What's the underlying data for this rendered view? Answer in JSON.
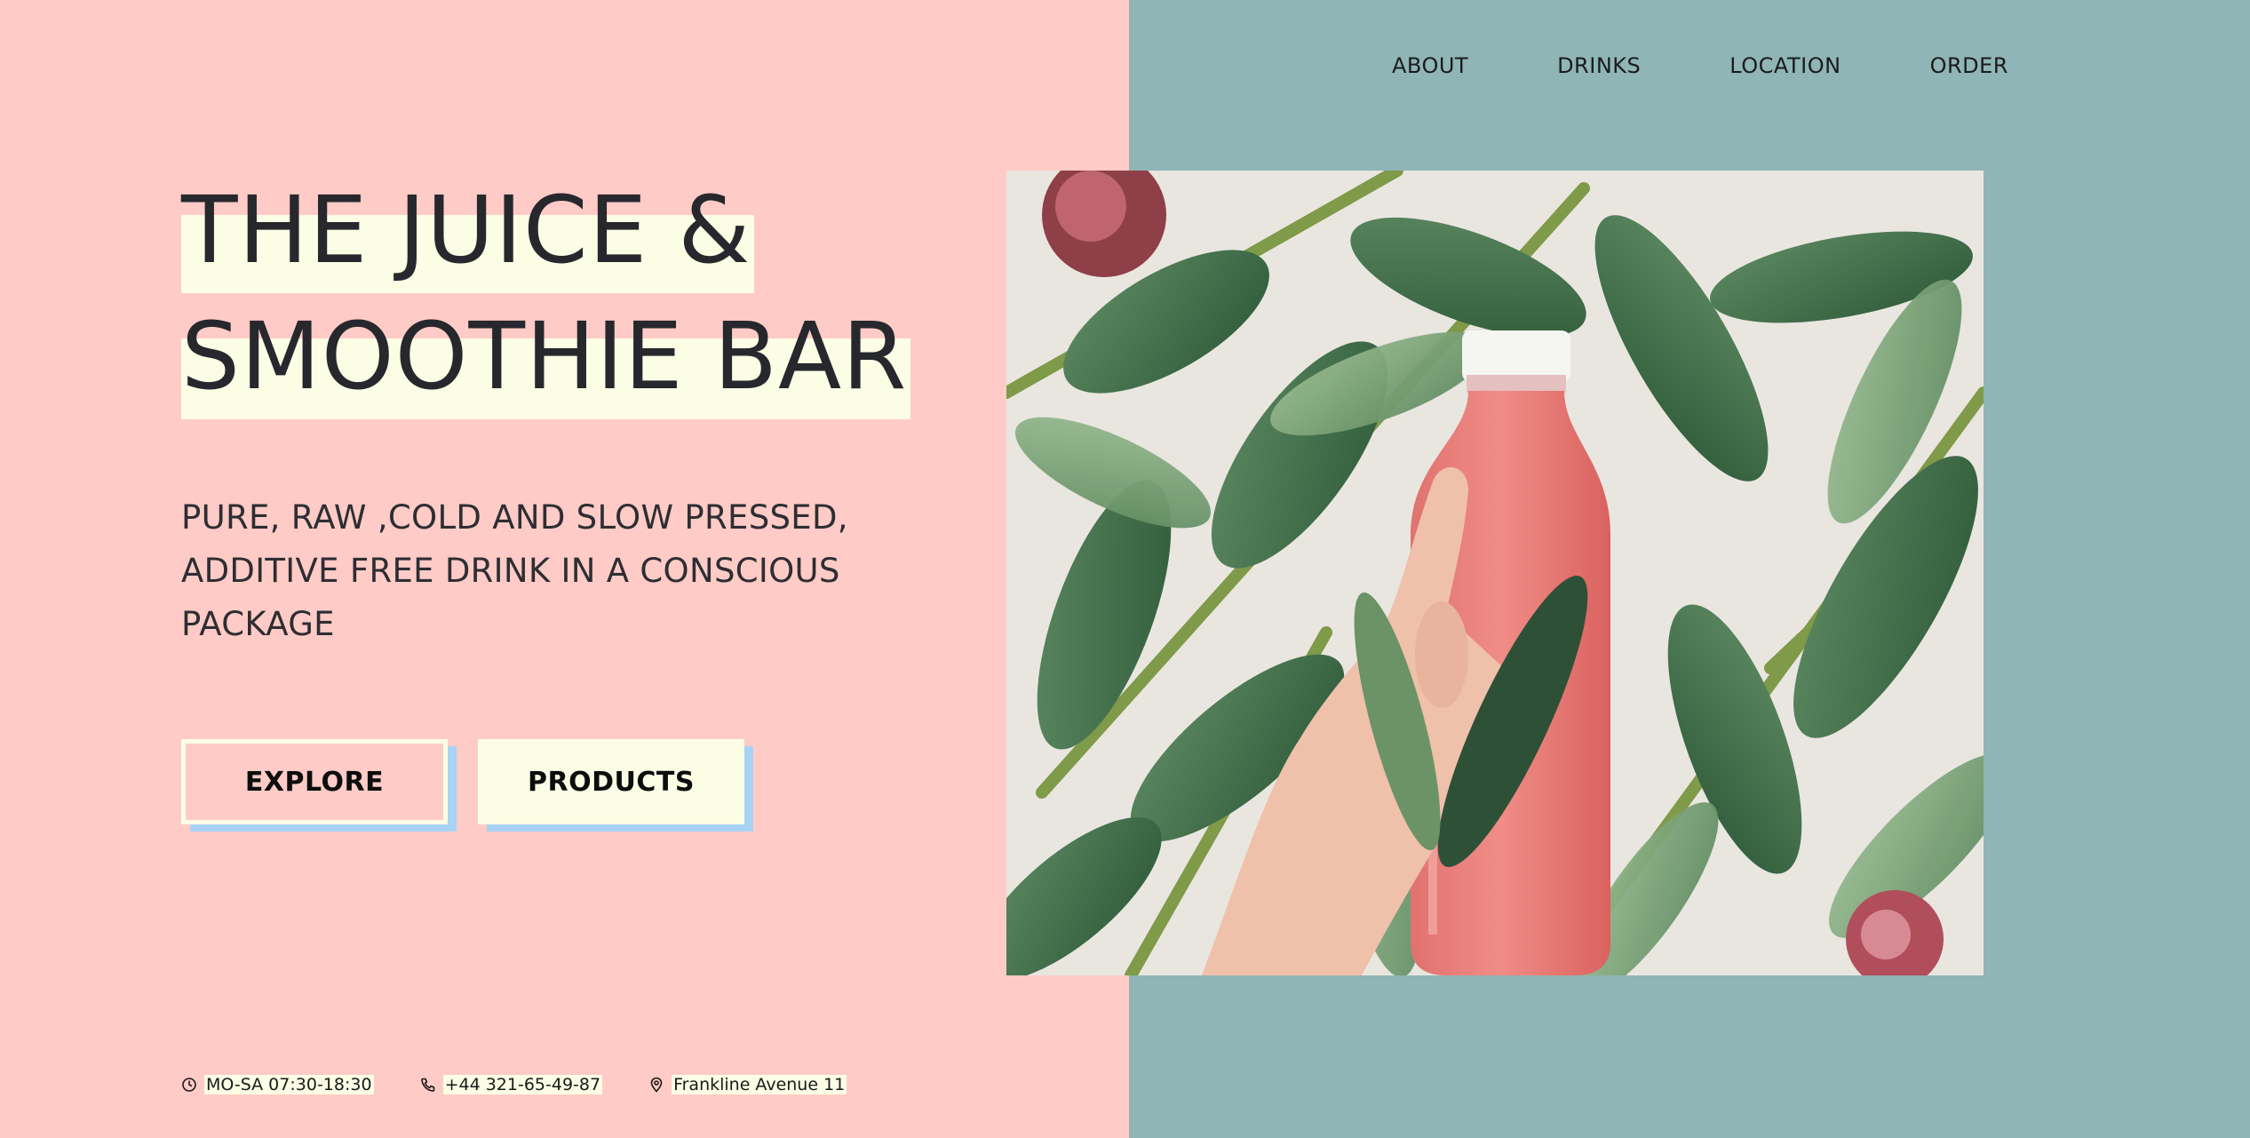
{
  "nav": {
    "items": [
      {
        "label": "ABOUT"
      },
      {
        "label": "DRINKS"
      },
      {
        "label": "LOCATION"
      },
      {
        "label": "ORDER"
      }
    ]
  },
  "hero": {
    "title_line1": "THE JUICE &",
    "title_line2": "SMOOTHIE BAR",
    "subtitle": "PURE, RAW ,COLD AND SLOW PRESSED, ADDITIVE FREE DRINK IN A CONSCIOUS PACKAGE",
    "explore_label": "EXPLORE",
    "products_label": "PRODUCTS",
    "image_alt": "hand holding pink juice bottle among green leaves"
  },
  "info": {
    "hours": {
      "icon": "clock-icon",
      "text": "MO-SA 07:30-18:30"
    },
    "phone": {
      "icon": "phone-icon",
      "text": "+44 321-65-49-87"
    },
    "address": {
      "icon": "location-pin-icon",
      "text": "Frankline Avenue 11"
    }
  },
  "colors": {
    "left_bg": "#ffcbc6",
    "right_bg": "#8fb5b6",
    "highlight": "#fbfee5",
    "button_shadow": "#a9d3f5",
    "text": "#27282d"
  }
}
